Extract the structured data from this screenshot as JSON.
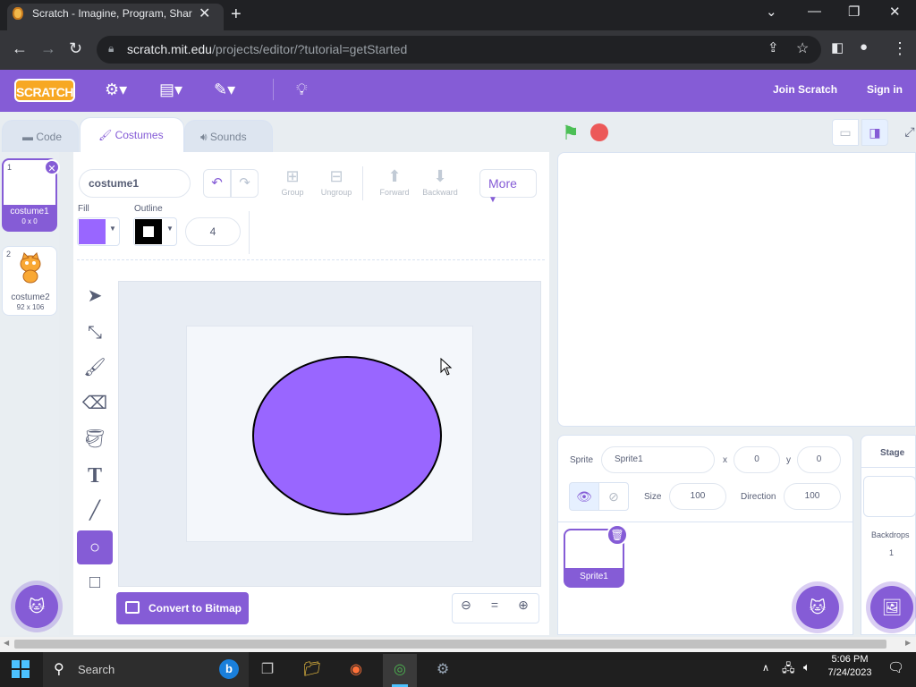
{
  "browser": {
    "tab_title": "Scratch - Imagine, Program, Shar",
    "url_host": "scratch.mit.edu",
    "url_path": "/projects/editor/?tutorial=getStarted"
  },
  "menubar": {
    "logo": "SCRATCH",
    "join": "Join Scratch",
    "signin": "Sign in"
  },
  "tabs": {
    "code": "Code",
    "costumes": "Costumes",
    "sounds": "Sounds"
  },
  "costumes": [
    {
      "num": "1",
      "name": "costume1",
      "size": "0 x 0"
    },
    {
      "num": "2",
      "name": "costume2",
      "size": "92 x 106"
    }
  ],
  "paint": {
    "costume_name": "costume1",
    "group": "Group",
    "ungroup": "Ungroup",
    "forward": "Forward",
    "backward": "Backward",
    "more": "More",
    "fill_label": "Fill",
    "outline_label": "Outline",
    "stroke_width": "4",
    "fill_color": "#9966ff",
    "convert": "Convert to Bitmap"
  },
  "sprite": {
    "label": "Sprite",
    "name": "Sprite1",
    "x_label": "x",
    "x": "0",
    "y_label": "y",
    "y": "0",
    "size_label": "Size",
    "size": "100",
    "direction_label": "Direction",
    "direction": "100",
    "thumb_name": "Sprite1"
  },
  "stage": {
    "label": "Stage",
    "backdrops_label": "Backdrops",
    "backdrops_count": "1"
  },
  "taskbar": {
    "search": "Search",
    "time": "5:06 PM",
    "date": "7/24/2023"
  },
  "colors": {
    "accent": "#855cd6",
    "costume_fill": "#9966ff"
  }
}
